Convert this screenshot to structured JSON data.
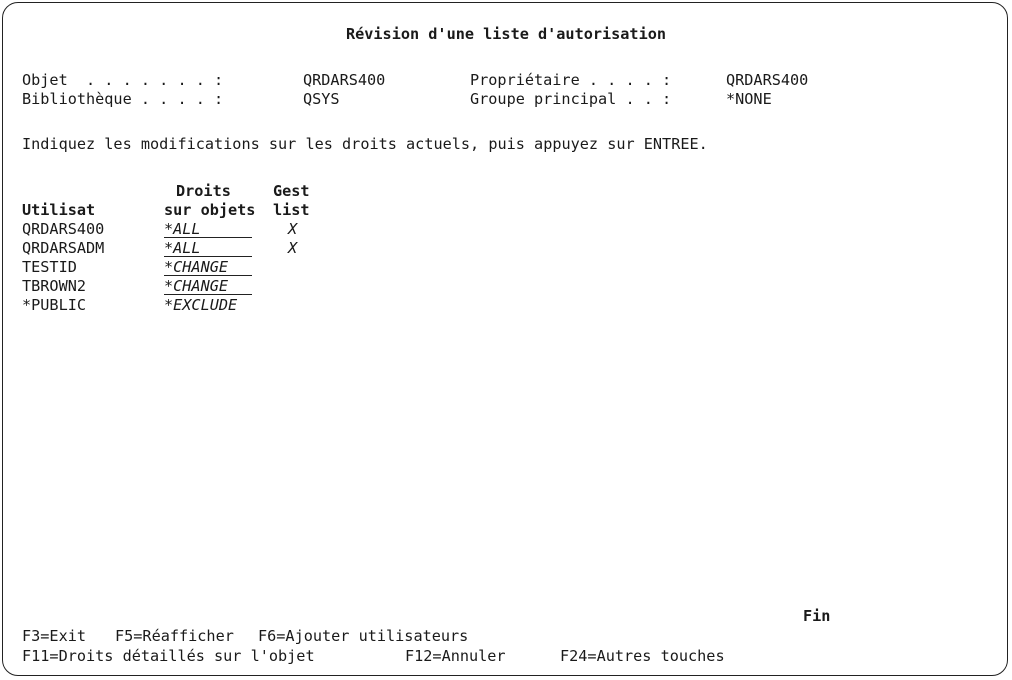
{
  "screen": {
    "title": "Révision d'une liste d'autorisation",
    "object_label": "Objet  . . . . . . . :",
    "object_value": "QRDARS400",
    "library_label": "Bibliothèque . . . . :",
    "library_value": "QSYS",
    "owner_label": "Propriétaire . . . . :",
    "owner_value": "QRDARS400",
    "group_label": "Groupe principal . . :",
    "group_value": "*NONE",
    "instruction": "Indiquez les modifications sur les droits actuels, puis appuyez sur ENTREE."
  },
  "table": {
    "header_user": "Utilisat",
    "header_rights_1": "Droits",
    "header_rights_2": "sur objets",
    "header_manage_1": "Gest",
    "header_manage_2": "list",
    "rows": [
      {
        "user": "QRDARS400",
        "rights": "*ALL",
        "manage": "X"
      },
      {
        "user": "QRDARSADM",
        "rights": "*ALL",
        "manage": "X"
      },
      {
        "user": "TESTID",
        "rights": "*CHANGE",
        "manage": ""
      },
      {
        "user": "TBROWN2",
        "rights": "*CHANGE",
        "manage": ""
      },
      {
        "user": "*PUBLIC",
        "rights": "*EXCLUDE",
        "manage": ""
      }
    ]
  },
  "footer": {
    "more_indicator": "Fin",
    "f3": "F3=Exit",
    "f5": "F5=Réafficher",
    "f6": "F6=Ajouter utilisateurs",
    "f11": "F11=Droits détaillés sur l'objet",
    "f12": "F12=Annuler",
    "f24": "F24=Autres touches"
  }
}
